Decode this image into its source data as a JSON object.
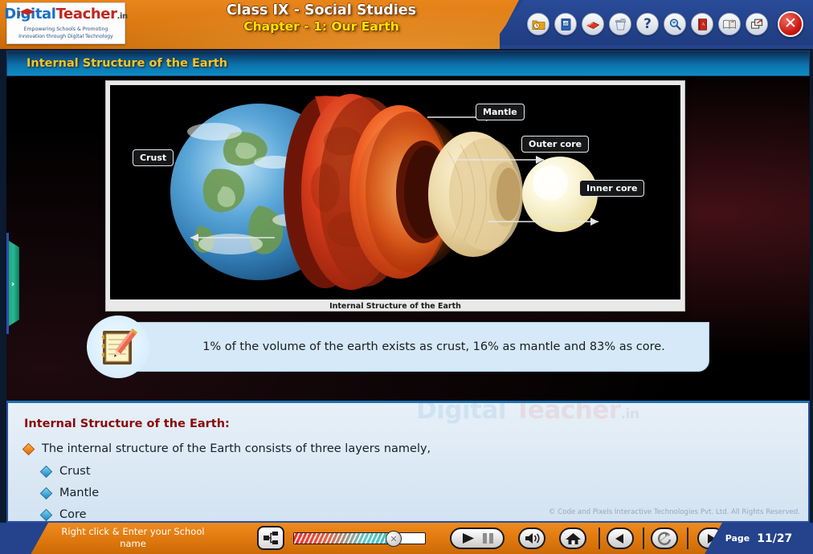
{
  "header": {
    "logo": {
      "name_part1": "Digital",
      "name_part2": "Teacher",
      "domain": ".in",
      "tagline_line1": "Empowering Schools & Promoting",
      "tagline_line2": "Innovation through Digital Technology",
      "cap_icon": "graduation-cap-icon"
    },
    "title_line1": "Class IX - Social Studies",
    "title_line2": "Chapter - 1: Our Earth",
    "toolbar_icons": [
      {
        "name": "folder-clock-icon",
        "label": "Recent"
      },
      {
        "name": "video-book-icon",
        "label": "Videos"
      },
      {
        "name": "red-book-icon",
        "label": "Book"
      },
      {
        "name": "trash-bin-icon",
        "label": "Bin"
      },
      {
        "name": "help-icon",
        "label": "?"
      },
      {
        "name": "search-magnifier-icon",
        "label": "Search"
      },
      {
        "name": "dictionary-icon",
        "label": "Dictionary"
      },
      {
        "name": "open-book-icon",
        "label": "Glossary"
      },
      {
        "name": "window-restore-icon",
        "label": "Window"
      }
    ],
    "close_label": "✕"
  },
  "section": {
    "title": "Internal Structure of the Earth"
  },
  "stage": {
    "sidebar_toggle": "›",
    "diagram": {
      "caption": "Internal Structure of the Earth",
      "labels": [
        {
          "name": "label-crust",
          "text": "Crust"
        },
        {
          "name": "label-mantle",
          "text": "Mantle"
        },
        {
          "name": "label-outer-core",
          "text": "Outer core"
        },
        {
          "name": "label-inner-core",
          "text": "Inner core"
        }
      ]
    },
    "note": {
      "icon": "notepad-pencil-icon",
      "text": "1% of the volume of the earth exists as crust, 16% as mantle and 83% as core."
    }
  },
  "content": {
    "heading": "Internal Structure of the Earth:",
    "main_bullet": "The internal structure of the Earth consists of three layers namely,",
    "sub_bullets": [
      {
        "text": "Crust"
      },
      {
        "text": "Mantle"
      },
      {
        "text": "Core"
      }
    ],
    "watermark_part1": "Digital",
    "watermark_part2": " Teacher",
    "watermark_domain": ".in",
    "copyright": "© Code and Pixels Interactive Technologies  Pvt. Ltd. All Rights Reserved."
  },
  "footer": {
    "school_prompt_line1": "Right click & Enter your School",
    "school_prompt_line2": "name",
    "tree_icon": "outline-tree-icon",
    "controls": [
      {
        "name": "play-pause-button",
        "icon": "play-pause-icon"
      },
      {
        "name": "volume-button",
        "icon": "speaker-icon"
      },
      {
        "name": "home-button",
        "icon": "home-icon"
      },
      {
        "name": "previous-button",
        "icon": "previous-icon"
      },
      {
        "name": "refresh-button",
        "icon": "refresh-icon"
      },
      {
        "name": "next-button",
        "icon": "next-icon"
      }
    ],
    "page_label": "Page",
    "page_value": "11/27"
  },
  "colors": {
    "orange": "#e07a10",
    "navy": "#24438c",
    "section_blue": "#0b8cc4",
    "accent_yellow": "#ffc425",
    "heading_red": "#8a0b0b"
  }
}
